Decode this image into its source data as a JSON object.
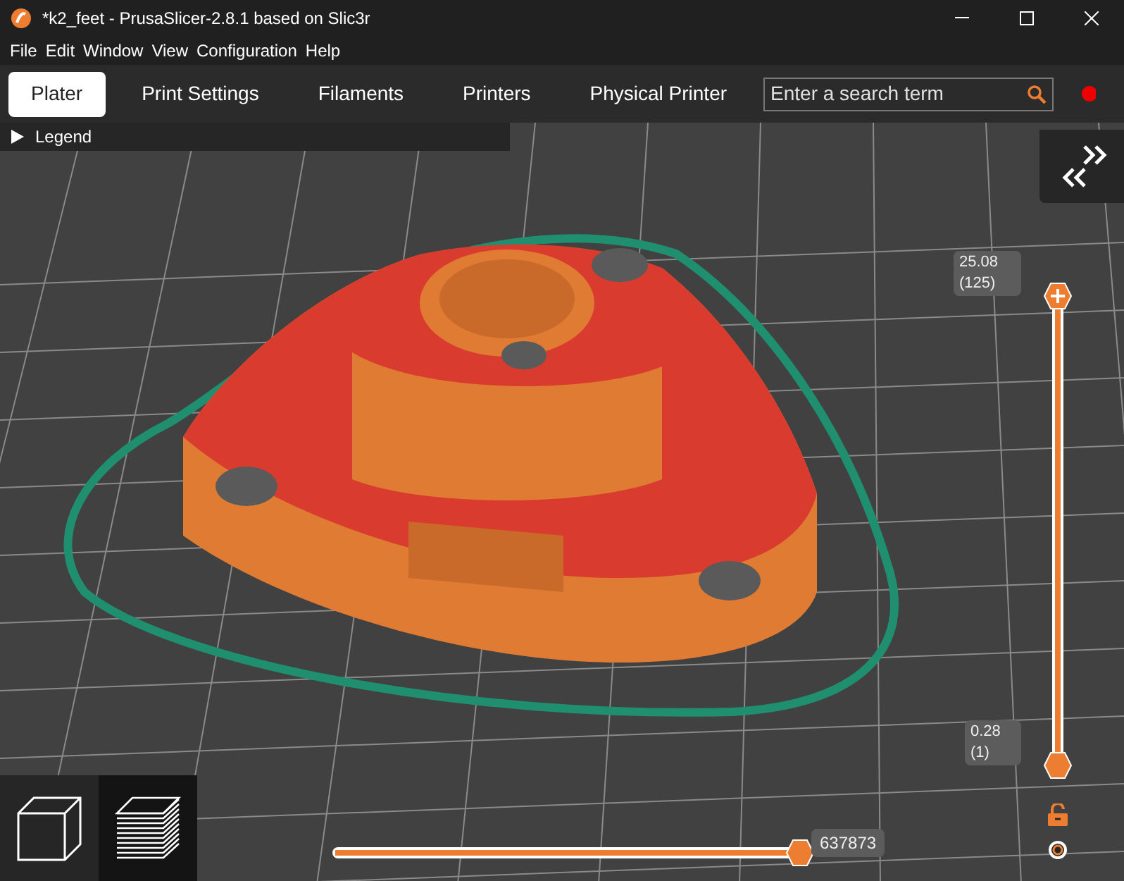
{
  "window": {
    "title": "*k2_feet - PrusaSlicer-2.8.1 based on Slic3r"
  },
  "menu": [
    "File",
    "Edit",
    "Window",
    "View",
    "Configuration",
    "Help"
  ],
  "tabs": [
    {
      "label": "Plater",
      "selected": true
    },
    {
      "label": "Print Settings",
      "selected": false
    },
    {
      "label": "Filaments",
      "selected": false
    },
    {
      "label": "Printers",
      "selected": false
    },
    {
      "label": "Physical Printer",
      "selected": false
    }
  ],
  "search": {
    "placeholder": "Enter a search term"
  },
  "legend": {
    "label": "Legend",
    "expanded": false
  },
  "view_buttons": [
    {
      "kind": "solid",
      "selected": false
    },
    {
      "kind": "preview",
      "selected": true
    }
  ],
  "layer_slider": {
    "upper": {
      "value": "25.08",
      "layer": "(125)",
      "level": 1
    },
    "lower": {
      "value": "0.28",
      "layer": "(1)",
      "level": 0
    }
  },
  "move_slider": {
    "value": "637873",
    "level": 1
  }
}
